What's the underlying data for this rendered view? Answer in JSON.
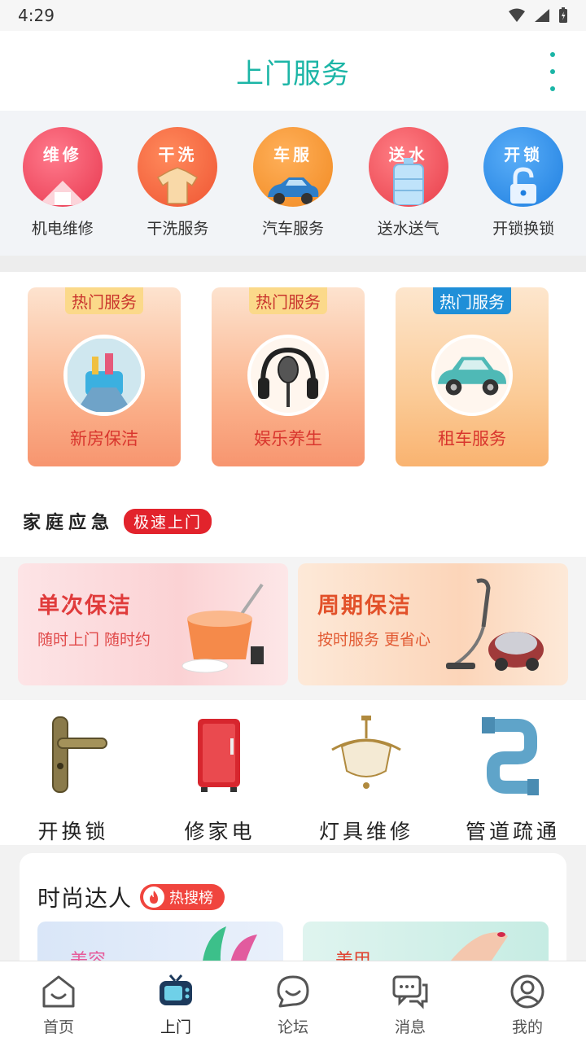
{
  "status": {
    "time": "4:29"
  },
  "header": {
    "title": "上门服务"
  },
  "categories": [
    {
      "badge": "维修",
      "label": "机电维修",
      "color": "#f2526a"
    },
    {
      "badge": "干洗",
      "label": "干洗服务",
      "color": "#f5613f"
    },
    {
      "badge": "车服",
      "label": "汽车服务",
      "color": "#f7932b"
    },
    {
      "badge": "送水",
      "label": "送水送气",
      "color": "#ef4a55"
    },
    {
      "badge": "开锁",
      "label": "开锁换锁",
      "color": "#2a8ff0"
    }
  ],
  "hot": [
    {
      "tag": "热门服务",
      "label": "新房保洁"
    },
    {
      "tag": "热门服务",
      "label": "娱乐养生"
    },
    {
      "tag": "热门服务",
      "label": "租车服务"
    }
  ],
  "emergency": {
    "title": "家庭应急",
    "badge": "极速上门"
  },
  "cleaning": [
    {
      "title": "单次保洁",
      "subtitle": "随时上门 随时约"
    },
    {
      "title": "周期保洁",
      "subtitle": "按时服务 更省心"
    }
  ],
  "tools": [
    {
      "label": "开换锁"
    },
    {
      "label": "修家电"
    },
    {
      "label": "灯具维修"
    },
    {
      "label": "管道疏通"
    }
  ],
  "fashion": {
    "title": "时尚达人",
    "badge": "热搜榜",
    "thumbs": [
      "美容",
      "美甲"
    ]
  },
  "nav": [
    {
      "label": "首页",
      "icon": "home-icon"
    },
    {
      "label": "上门",
      "icon": "tv-icon",
      "active": true
    },
    {
      "label": "论坛",
      "icon": "chat-smile-icon"
    },
    {
      "label": "消息",
      "icon": "message-icon"
    },
    {
      "label": "我的",
      "icon": "profile-icon"
    }
  ]
}
